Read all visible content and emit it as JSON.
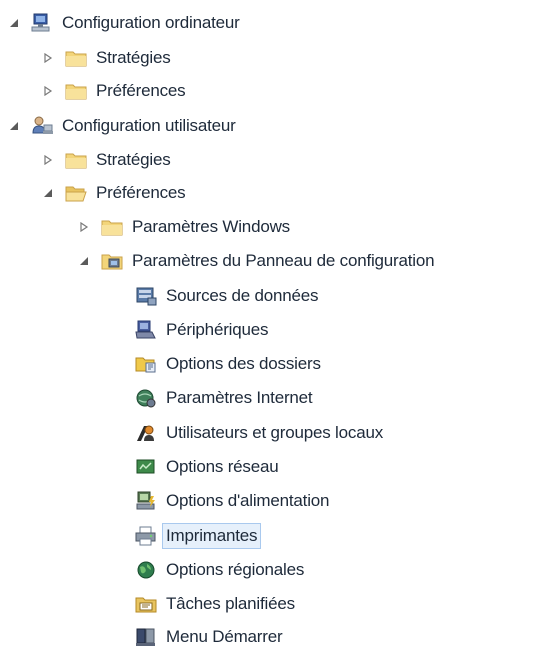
{
  "tree": {
    "computer_config": {
      "label": "Configuration ordinateur",
      "icon": "computer-config-icon",
      "children": {
        "strategies": {
          "label": "Stratégies",
          "icon": "folder-icon"
        },
        "preferences": {
          "label": "Préférences",
          "icon": "folder-icon"
        }
      }
    },
    "user_config": {
      "label": "Configuration utilisateur",
      "icon": "user-config-icon",
      "children": {
        "strategies": {
          "label": "Stratégies",
          "icon": "folder-icon"
        },
        "preferences": {
          "label": "Préférences",
          "icon": "folder-open-icon",
          "children": {
            "windows_settings": {
              "label": "Paramètres Windows",
              "icon": "folder-icon"
            },
            "control_panel_settings": {
              "label": "Paramètres du Panneau de configuration",
              "icon": "control-panel-folder-icon",
              "items": [
                {
                  "label": "Sources de données",
                  "icon": "data-sources-icon"
                },
                {
                  "label": "Périphériques",
                  "icon": "devices-icon"
                },
                {
                  "label": "Options des dossiers",
                  "icon": "folder-options-icon"
                },
                {
                  "label": "Paramètres Internet",
                  "icon": "internet-settings-icon"
                },
                {
                  "label": "Utilisateurs et groupes locaux",
                  "icon": "local-users-groups-icon"
                },
                {
                  "label": "Options réseau",
                  "icon": "network-options-icon"
                },
                {
                  "label": "Options d'alimentation",
                  "icon": "power-options-icon"
                },
                {
                  "label": "Imprimantes",
                  "icon": "printers-icon",
                  "selected": true
                },
                {
                  "label": "Options régionales",
                  "icon": "regional-options-icon"
                },
                {
                  "label": "Tâches planifiées",
                  "icon": "scheduled-tasks-icon"
                },
                {
                  "label": "Menu Démarrer",
                  "icon": "start-menu-icon"
                }
              ]
            }
          }
        }
      }
    }
  },
  "colors": {
    "selection_background": "#e6f0fb",
    "selection_border": "#a9c9ee",
    "folder_yellow": "#f3d57a",
    "text": "#1e2a3a"
  }
}
